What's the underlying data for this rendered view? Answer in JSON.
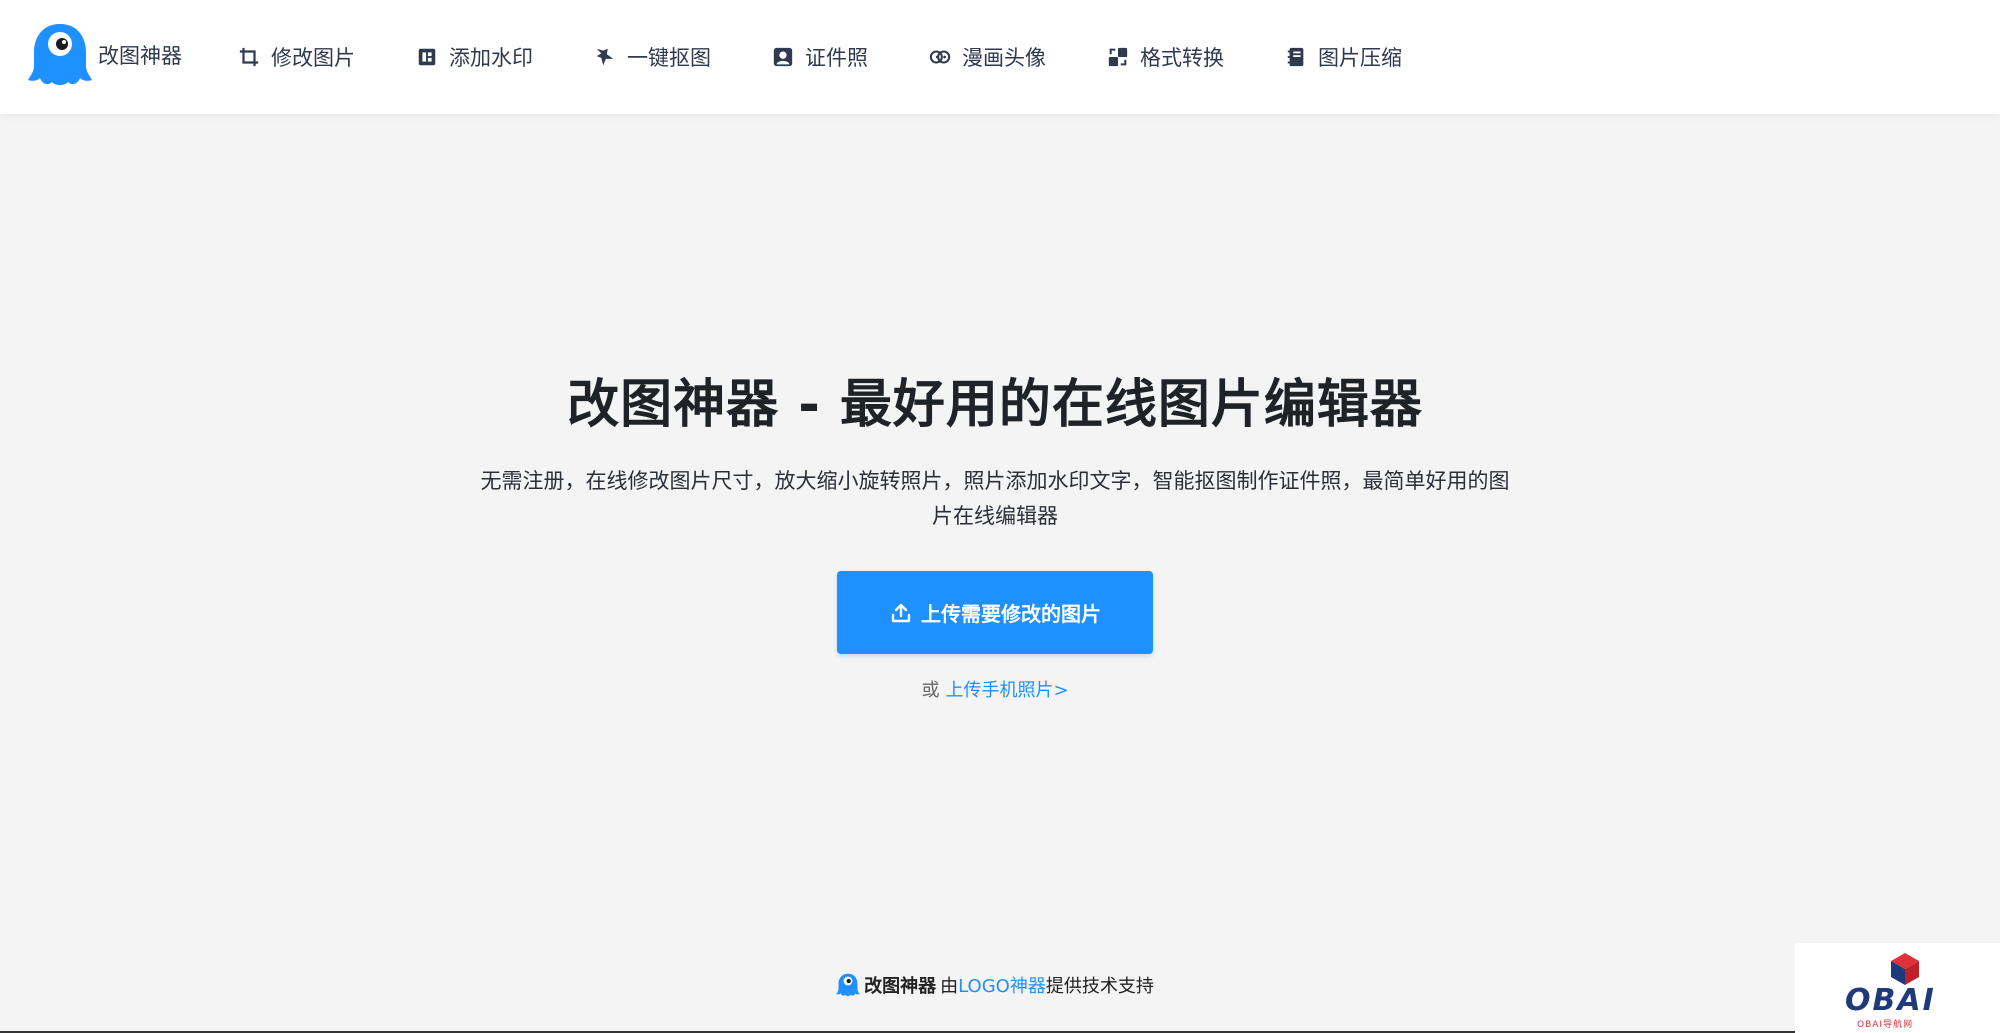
{
  "header": {
    "brand_name": "改图神器",
    "nav": [
      {
        "label": "修改图片",
        "icon": "crop-icon"
      },
      {
        "label": "添加水印",
        "icon": "watermark-icon"
      },
      {
        "label": "一键抠图",
        "icon": "magic-icon"
      },
      {
        "label": "证件照",
        "icon": "id-photo-icon"
      },
      {
        "label": "漫画头像",
        "icon": "cartoon-icon"
      },
      {
        "label": "格式转换",
        "icon": "convert-icon"
      },
      {
        "label": "图片压缩",
        "icon": "compress-icon"
      }
    ]
  },
  "hero": {
    "title": "改图神器 - 最好用的在线图片编辑器",
    "description": "无需注册，在线修改图片尺寸，放大缩小旋转照片，照片添加水印文字，智能抠图制作证件照，最简单好用的图片在线编辑器",
    "upload_button": "上传需要修改的图片",
    "alt_prefix": "或",
    "alt_link": "上传手机照片>"
  },
  "footer": {
    "brand": "改图神器",
    "by": "由",
    "link": "LOGO神器",
    "suffix": "提供技术支持"
  },
  "watermark": {
    "text": "OBAI",
    "sub": "OBAI导航网"
  },
  "colors": {
    "accent": "#1e90ff",
    "background": "#f4f4f4",
    "header_bg": "#ffffff"
  }
}
